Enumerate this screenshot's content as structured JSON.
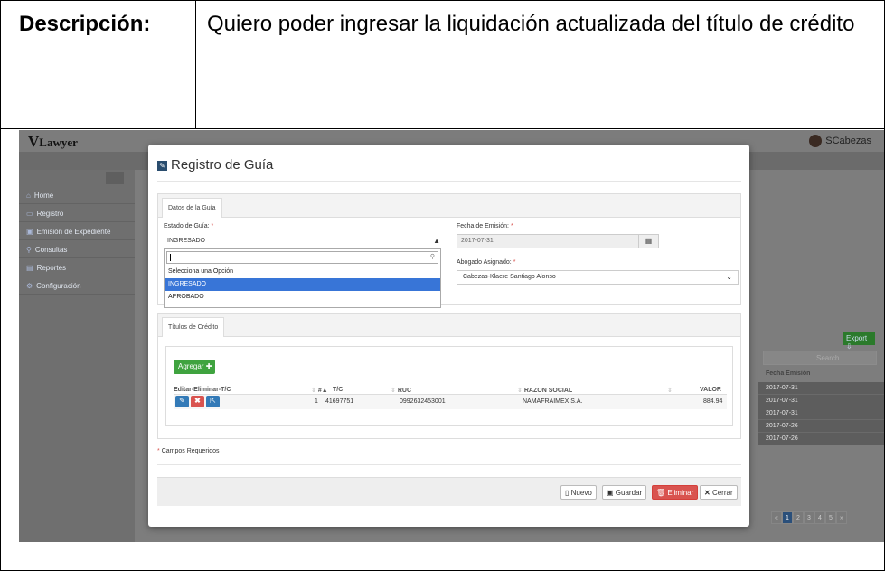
{
  "document": {
    "label": "Descripción:",
    "value": "Quiero poder ingresar la liquidación actualizada del título de crédito"
  },
  "app": {
    "logo": "Lawyer",
    "user": "SCabezas"
  },
  "sidebar": {
    "items": [
      {
        "label": "Home",
        "icon": "home-icon"
      },
      {
        "label": "Registro",
        "icon": "keyboard-icon"
      },
      {
        "label": "Emisión de Expediente",
        "icon": "id-card-icon"
      },
      {
        "label": "Consultas",
        "icon": "search-icon"
      },
      {
        "label": "Reportes",
        "icon": "report-icon"
      },
      {
        "label": "Configuración",
        "icon": "gear-icon"
      }
    ]
  },
  "background_table": {
    "export_label": "Export",
    "search_placeholder": "Search",
    "header": "Fecha Emisión",
    "dates": [
      "2017-07-31",
      "2017-07-31",
      "2017-07-31",
      "2017-07-26",
      "2017-07-26"
    ],
    "pages": [
      "«",
      "1",
      "2",
      "3",
      "4",
      "5",
      "»"
    ]
  },
  "modal": {
    "title": "Registro de Guía",
    "tab_datos": "Datos de la Guía",
    "estado_label": "Estado de Guía:",
    "estado_value": "INGRESADO",
    "estado_options": [
      "Selecciona una Opción",
      "INGRESADO",
      "APROBADO"
    ],
    "fecha_label": "Fecha de Emisión:",
    "fecha_value": "2017-07-31",
    "abogado_label": "Abogado Asignado:",
    "abogado_value": "Cabezas-Klaere Santiago Alonso",
    "required_mark": "*",
    "tab_titulos": "Títulos de Crédito",
    "agregar_label": "Agregar",
    "columns": [
      "Editar-Eliminar-T/C",
      "#",
      "T/C",
      "RUC",
      "RAZON SOCIAL",
      "VALOR"
    ],
    "rows": [
      {
        "num": "1",
        "tc": "41697751",
        "ruc": "0992632453001",
        "razon": "NAMAFRAIMEX S.A.",
        "valor": "884.94"
      }
    ],
    "campos_requeridos": "Campos Requeridos",
    "buttons": {
      "nuevo": "Nuevo",
      "guardar": "Guardar",
      "eliminar": "Eliminar",
      "cerrar": "Cerrar"
    }
  }
}
